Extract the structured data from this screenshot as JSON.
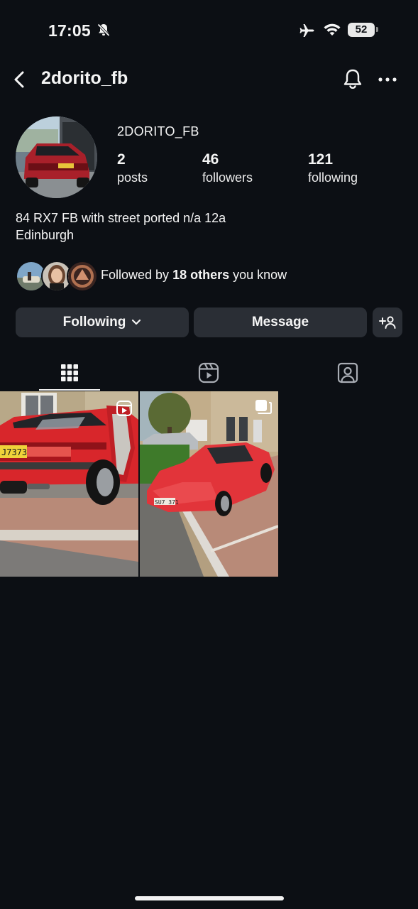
{
  "status_bar": {
    "time": "17:05",
    "battery": "52",
    "icons": [
      "bell-muted-icon",
      "airplane-icon",
      "wifi-icon",
      "battery-icon"
    ]
  },
  "header": {
    "username": "2dorito_fb",
    "icons": [
      "back-chevron-icon",
      "notification-bell-icon",
      "more-options-icon"
    ]
  },
  "profile": {
    "display_name": "2DORITO_FB",
    "stats": [
      {
        "value": "2",
        "label": "posts"
      },
      {
        "value": "46",
        "label": "followers"
      },
      {
        "value": "121",
        "label": "following"
      }
    ],
    "bio_line1": "84 RX7 FB with street ported n/a 12a",
    "bio_line2": "Edinburgh"
  },
  "mutual": {
    "prefix": "Followed by ",
    "count_text": "18 others",
    "suffix": " you know"
  },
  "actions": {
    "following_label": "Following",
    "message_label": "Message"
  },
  "tabs": [
    {
      "name": "posts-grid",
      "icon": "grid-icon",
      "active": true
    },
    {
      "name": "reels",
      "icon": "reels-icon",
      "active": false
    },
    {
      "name": "tagged",
      "icon": "tagged-person-icon",
      "active": false
    }
  ],
  "colors": {
    "background": "#0c0f14",
    "button_bg": "#2a2e35",
    "text": "#f5f5f5",
    "car_red": "#d8262b"
  },
  "posts": [
    {
      "type": "reel",
      "icon": "reel-badge-icon"
    },
    {
      "type": "carousel",
      "icon": "carousel-badge-icon"
    }
  ]
}
